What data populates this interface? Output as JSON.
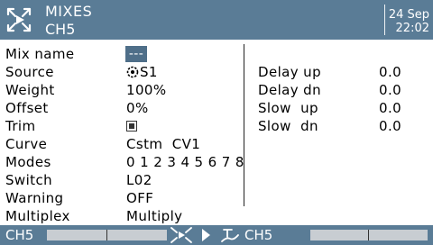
{
  "header": {
    "title": "MIXES",
    "subtitle": "CH5",
    "date": "24 Sep",
    "time": "22:02",
    "logo_icon": "radio-logo-icon",
    "background_color": "#5a7c96"
  },
  "fields": [
    {
      "label": "Mix name",
      "value": "---"
    },
    {
      "label": "Source",
      "value": "S1",
      "icon": "pot-icon"
    },
    {
      "label": "Weight",
      "value": "100%"
    },
    {
      "label": "Offset",
      "value": "0%"
    },
    {
      "label": "Trim",
      "value_type": "checkbox",
      "checked": true
    },
    {
      "label": "Curve",
      "value": "Cstm  CV1"
    },
    {
      "label": "Modes",
      "value": "0 1 2 3 4 5 6 7 8"
    },
    {
      "label": "Switch",
      "value": "L02"
    },
    {
      "label": "Warning",
      "value": "OFF"
    },
    {
      "label": "Multiplex",
      "value": "Multiply"
    }
  ],
  "timing": [
    {
      "label": "Delay up",
      "value": "0.0"
    },
    {
      "label": "Delay dn",
      "value": "0.0"
    },
    {
      "label": "Slow  up",
      "value": "0.0"
    },
    {
      "label": "Slow  dn",
      "value": "0.0"
    }
  ],
  "footer": {
    "left_channel": "CH5",
    "right_channel": "CH5",
    "icons": [
      "mixer-icon",
      "arrow-right-icon",
      "output-icon"
    ]
  }
}
